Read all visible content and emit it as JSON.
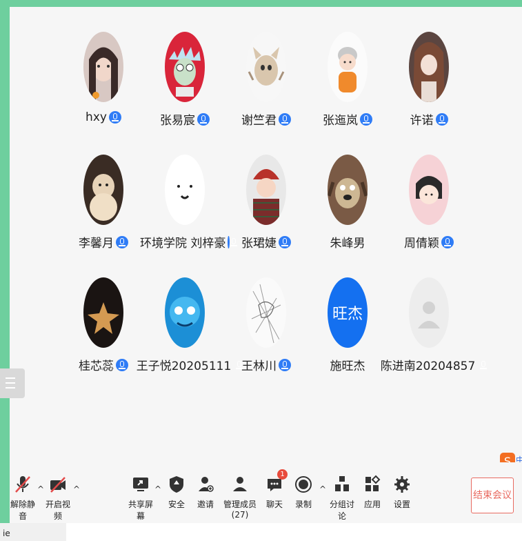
{
  "participants": [
    {
      "name": "hxy",
      "avatar": "girl-photo-avatar",
      "mic": true
    },
    {
      "name": "张易宸",
      "avatar": "cartoon-scientist-avatar",
      "mic": true
    },
    {
      "name": "谢竺君",
      "avatar": "cartoon-cat-avatar",
      "mic": true
    },
    {
      "name": "张迤岚",
      "avatar": "cartoon-boy-avatar",
      "mic": true
    },
    {
      "name": "许诺",
      "avatar": "anime-girl-avatar",
      "mic": true
    },
    {
      "name": "李馨月",
      "avatar": "dog-photo-avatar",
      "mic": true
    },
    {
      "name": "环境学院 刘梓豪",
      "avatar": "smiley-face-avatar",
      "mic": true
    },
    {
      "name": "张珺婕",
      "avatar": "cartoon-boy-hat-avatar",
      "mic": true
    },
    {
      "name": "朱峰男",
      "avatar": "cartoon-dog-avatar",
      "mic": false
    },
    {
      "name": "周倩颖",
      "avatar": "cartoon-girl-avatar",
      "mic": true
    },
    {
      "name": "桂芯蕊",
      "avatar": "star-plush-avatar",
      "mic": true
    },
    {
      "name": "王子悦20205111",
      "avatar": "blue-cartoon-avatar",
      "mic": true
    },
    {
      "name": "王林川",
      "avatar": "sketch-drawing-avatar",
      "mic": true
    },
    {
      "name": "施旺杰",
      "avatar": "text-initials-avatar",
      "initials": "旺杰",
      "mic": false
    },
    {
      "name": "陈进南20204857",
      "avatar": "default-user-avatar",
      "mic": true
    }
  ],
  "toolbar": {
    "unmute": "解除静音",
    "start_video": "开启视频",
    "share_screen": "共享屏幕",
    "security": "安全",
    "invite": "邀请",
    "manage_members": "管理成员(27)",
    "chat": "聊天",
    "chat_badge": "1",
    "record": "录制",
    "breakout": "分组讨论",
    "apps": "应用",
    "settings": "设置",
    "end_meeting": "结束会议"
  },
  "sogou_label": "中",
  "bottom_text": "ie",
  "colors": {
    "frame": "#6ecf9e",
    "accent_blue": "#2f7cf6",
    "end_red": "#e8695f"
  }
}
